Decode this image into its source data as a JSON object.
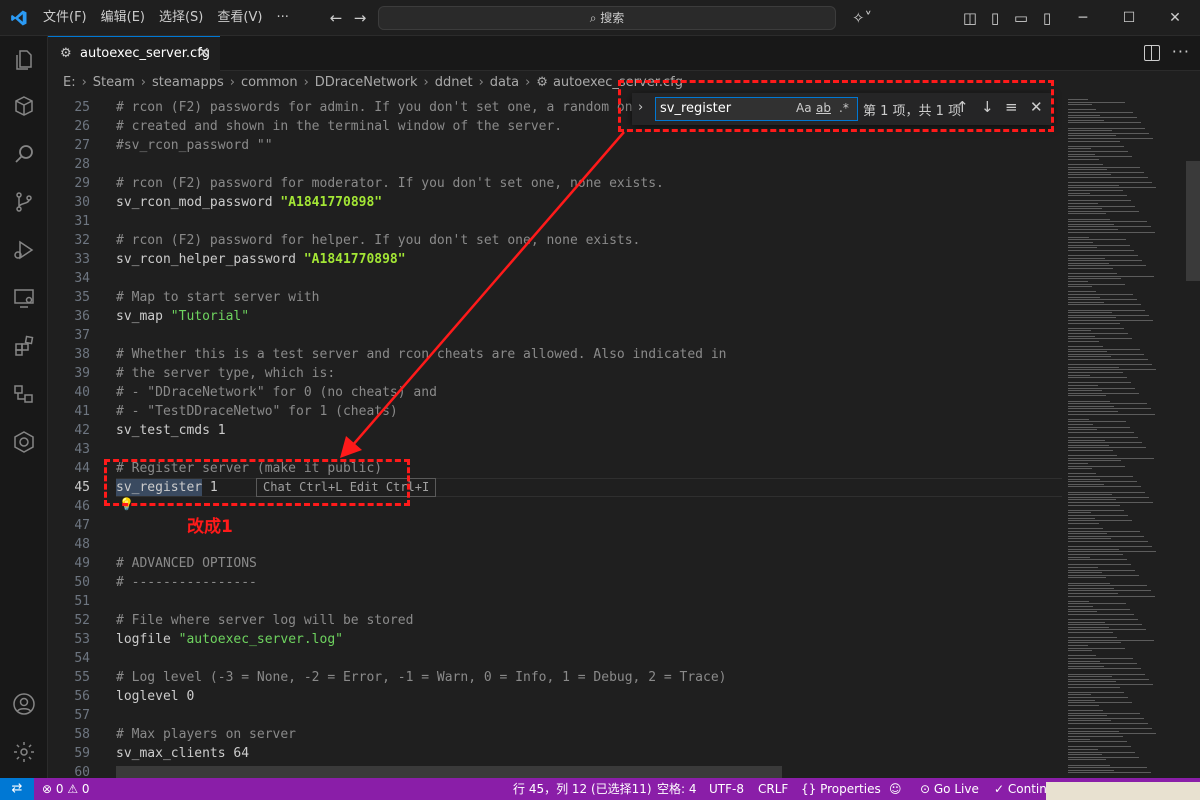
{
  "title_bar": {
    "menus": [
      "文件(F)",
      "编辑(E)",
      "选择(S)",
      "查看(V)",
      "···"
    ],
    "search_placeholder": "搜索"
  },
  "tab": {
    "name": "autoexec_server.cfg"
  },
  "breadcrumb": [
    "E:",
    "Steam",
    "steamapps",
    "common",
    "DDraceNetwork",
    "ddnet",
    "data",
    "autoexec_server.cfg"
  ],
  "find": {
    "query": "sv_register",
    "opt_case": "Aa",
    "opt_word": "ab",
    "opt_regex": ".*",
    "result": "第 1 项，共 1 项"
  },
  "editor": {
    "lines": [
      {
        "n": "25",
        "text": "# rcon (F2) passwords for admin. If you don't set one, a random one",
        "type": "comment"
      },
      {
        "n": "26",
        "text": "# created and shown in the terminal window of the server.",
        "type": "comment"
      },
      {
        "n": "27",
        "text": "#sv_rcon_password \"\"",
        "type": "comment"
      },
      {
        "n": "28",
        "text": "",
        "type": "plain"
      },
      {
        "n": "29",
        "text": "# rcon (F2) password for moderator. If you don't set one, none exists.",
        "type": "comment"
      },
      {
        "n": "30",
        "key": "sv_rcon_mod_password ",
        "val": "\"A1841770898\"",
        "type": "kv-bold"
      },
      {
        "n": "31",
        "text": "",
        "type": "plain"
      },
      {
        "n": "32",
        "text": "# rcon (F2) password for helper. If you don't set one, none exists.",
        "type": "comment"
      },
      {
        "n": "33",
        "key": "sv_rcon_helper_password ",
        "val": "\"A1841770898\"",
        "type": "kv-bold"
      },
      {
        "n": "34",
        "text": "",
        "type": "plain"
      },
      {
        "n": "35",
        "text": "# Map to start server with",
        "type": "comment"
      },
      {
        "n": "36",
        "key": "sv_map ",
        "val": "\"Tutorial\"",
        "type": "kv"
      },
      {
        "n": "37",
        "text": "",
        "type": "plain"
      },
      {
        "n": "38",
        "text": "# Whether this is a test server and rcon cheats are allowed. Also indicated in",
        "type": "comment"
      },
      {
        "n": "39",
        "text": "# the server type, which is:",
        "type": "comment"
      },
      {
        "n": "40",
        "text": "# - \"DDraceNetwork\" for 0 (no cheats) and",
        "type": "comment"
      },
      {
        "n": "41",
        "text": "# - \"TestDDraceNetwo\" for 1 (cheats)",
        "type": "comment"
      },
      {
        "n": "42",
        "text": "sv_test_cmds 1",
        "type": "plain"
      },
      {
        "n": "43",
        "text": "",
        "type": "plain"
      },
      {
        "n": "44",
        "text": "# Register server (make it public)",
        "type": "comment"
      },
      {
        "n": "45",
        "text": "sv_register 1",
        "type": "plain"
      },
      {
        "n": "46",
        "text": "",
        "type": "plain"
      },
      {
        "n": "47",
        "text": "",
        "type": "plain"
      },
      {
        "n": "48",
        "text": "",
        "type": "plain"
      },
      {
        "n": "49",
        "text": "# ADVANCED OPTIONS",
        "type": "comment"
      },
      {
        "n": "50",
        "text": "# ----------------",
        "type": "comment"
      },
      {
        "n": "51",
        "text": "",
        "type": "plain"
      },
      {
        "n": "52",
        "text": "# File where server log will be stored",
        "type": "comment"
      },
      {
        "n": "53",
        "key": "logfile ",
        "val": "\"autoexec_server.log\"",
        "type": "kv"
      },
      {
        "n": "54",
        "text": "",
        "type": "plain"
      },
      {
        "n": "55",
        "text": "# Log level (-3 = None, -2 = Error, -1 = Warn, 0 = Info, 1 = Debug, 2 = Trace)",
        "type": "comment"
      },
      {
        "n": "56",
        "text": "loglevel 0",
        "type": "plain"
      },
      {
        "n": "57",
        "text": "",
        "type": "plain"
      },
      {
        "n": "58",
        "text": "# Max players on server",
        "type": "comment"
      },
      {
        "n": "59",
        "text": "sv_max_clients 64",
        "type": "plain"
      },
      {
        "n": "60",
        "text": "",
        "type": "plain"
      }
    ],
    "current_line": "45",
    "inline_hint": "Chat Ctrl+L Edit Ctrl+I"
  },
  "annotation": {
    "text": "改成1",
    "color": "#ff1a1a"
  },
  "status_bar": {
    "errors": "0",
    "warnings": "0",
    "position": "行 45，列 12 (已选择11)",
    "spaces": "空格: 4",
    "encoding": "UTF-8",
    "eol": "CRLF",
    "language": "{} Properties",
    "go_live": "Go Live",
    "continue": "Contin",
    "bg_color": "#8a1ea8"
  }
}
